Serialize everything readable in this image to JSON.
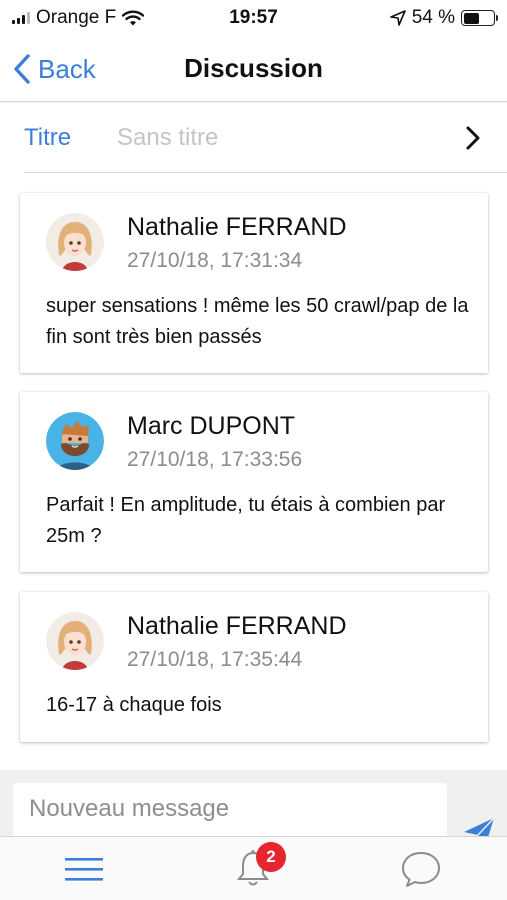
{
  "status_bar": {
    "carrier": "Orange F",
    "time": "19:57",
    "battery_percent": "54 %",
    "battery_level": 0.54
  },
  "nav": {
    "back_label": "Back",
    "title": "Discussion"
  },
  "title_row": {
    "label": "Titre",
    "value": "Sans titre"
  },
  "messages": [
    {
      "author": "Nathalie FERRAND",
      "timestamp": "27/10/18, 17:31:34",
      "text": "super sensations ! même les 50 crawl/pap de la fin sont très bien passés"
    },
    {
      "author": "Marc DUPONT",
      "timestamp": "27/10/18, 17:33:56",
      "text": "Parfait ! En amplitude, tu étais à combien par 25m ?"
    },
    {
      "author": "Nathalie FERRAND",
      "timestamp": "27/10/18, 17:35:44",
      "text": "16-17 à chaque fois"
    }
  ],
  "composer": {
    "placeholder": "Nouveau message"
  },
  "tab_bar": {
    "notification_count": "2"
  },
  "colors": {
    "accent": "#3b7fd8",
    "badge": "#e5262e",
    "placeholder": "#c4c4c4",
    "timestamp": "#8c8c8c"
  }
}
